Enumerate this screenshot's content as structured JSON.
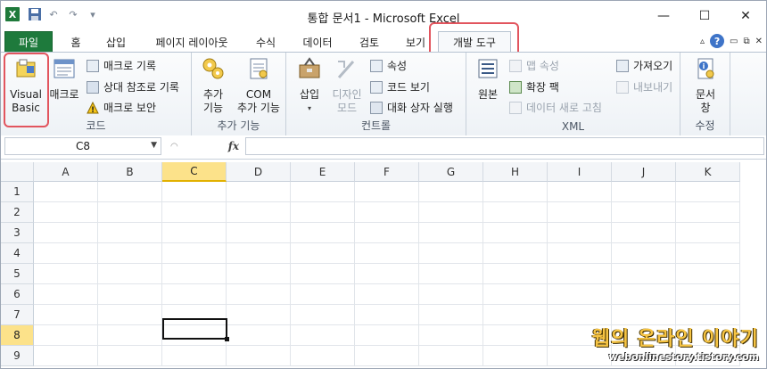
{
  "window": {
    "title": "통합 문서1 - Microsoft Excel",
    "minimize": "—",
    "restore": "☐",
    "close": "✕"
  },
  "qat": {
    "undo": "↶",
    "redo": "↷",
    "customize": "▾"
  },
  "tabs": [
    "파일",
    "홈",
    "삽입",
    "페이지 레이아웃",
    "수식",
    "데이터",
    "검토",
    "보기",
    "개발 도구"
  ],
  "ribbon": {
    "code": {
      "label": "코드",
      "visual_basic": [
        "Visual",
        "Basic"
      ],
      "macros": "매크로",
      "record_macro": "매크로 기록",
      "relative_ref": "상대 참조로 기록",
      "macro_security": "매크로 보안"
    },
    "addins": {
      "label": "추가 기능",
      "addins_btn": [
        "추가",
        "기능"
      ],
      "com_btn": [
        "COM",
        "추가 기능"
      ]
    },
    "controls": {
      "label": "컨트롤",
      "insert": "삽입",
      "design_mode": [
        "디자인",
        "모드"
      ],
      "properties": "속성",
      "view_code": "코드 보기",
      "run_dialog": "대화 상자 실행"
    },
    "xml": {
      "label": "XML",
      "source": "원본",
      "map_props": "맵 속성",
      "expansion_packs": "확장 팩",
      "refresh_data": "데이터 새로 고침",
      "import": "가져오기",
      "export": "내보내기"
    },
    "modify": {
      "label": "수정",
      "doc_panel": [
        "문서",
        "창"
      ]
    }
  },
  "formula_bar": {
    "name_box": "C8",
    "fx": "fx",
    "value": ""
  },
  "grid": {
    "columns": [
      "A",
      "B",
      "C",
      "D",
      "E",
      "F",
      "G",
      "H",
      "I",
      "J",
      "K"
    ],
    "rows": [
      "1",
      "2",
      "3",
      "4",
      "5",
      "6",
      "7",
      "8",
      "9"
    ],
    "selected_column": "C",
    "selected_row": "8"
  },
  "watermark": {
    "line1": "웹의 온라인 이야기",
    "line2": "webonlinestory.tistory.com"
  },
  "colors": {
    "file_tab": "#1e7a3c",
    "highlight": "#e2555e",
    "selection": "#fce28a"
  }
}
